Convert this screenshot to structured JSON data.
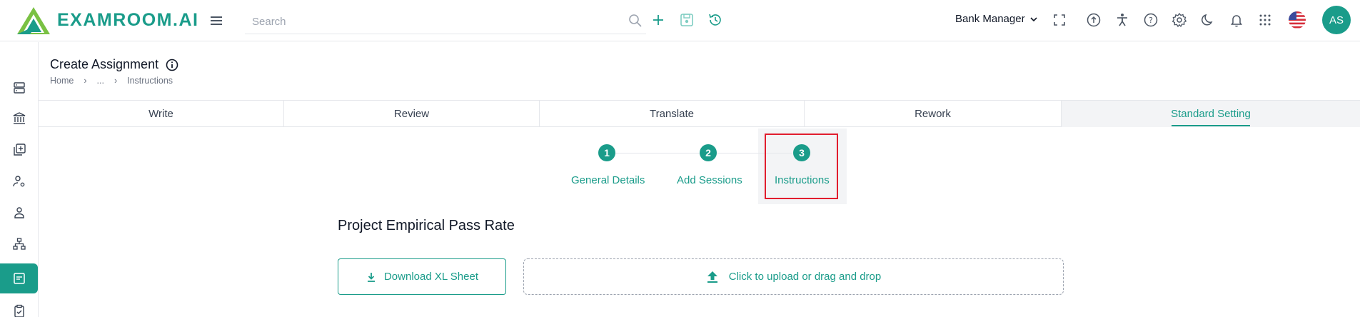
{
  "app": {
    "logo_text": "EXAMROOM.AI",
    "brand_color": "#1a9c8a"
  },
  "header": {
    "search_placeholder": "Search",
    "role_label": "Bank Manager",
    "avatar_initials": "AS",
    "icons": [
      "search-icon",
      "plus-icon",
      "save-icon",
      "history-icon",
      "fullscreen-icon",
      "upload-circle-icon",
      "accessibility-icon",
      "help-icon",
      "settings-icon",
      "dark-mode-icon",
      "notification-icon",
      "apps-grid-icon",
      "us-flag-icon"
    ]
  },
  "sidebar": {
    "items": [
      {
        "icon": "server-icon",
        "active": false
      },
      {
        "icon": "bank-icon",
        "active": false
      },
      {
        "icon": "add-copy-icon",
        "active": false
      },
      {
        "icon": "user-settings-icon",
        "active": false
      },
      {
        "icon": "user-icon",
        "active": false
      },
      {
        "icon": "hierarchy-icon",
        "active": false
      },
      {
        "icon": "assignment-icon",
        "active": true
      },
      {
        "icon": "clipboard-check-icon",
        "active": false
      }
    ]
  },
  "page": {
    "title": "Create Assignment",
    "breadcrumb": [
      "Home",
      "...",
      "Instructions"
    ],
    "breadcrumb_sep": "›"
  },
  "tabs": [
    {
      "label": "Write",
      "active": false
    },
    {
      "label": "Review",
      "active": false
    },
    {
      "label": "Translate",
      "active": false
    },
    {
      "label": "Rework",
      "active": false
    },
    {
      "label": "Standard Setting",
      "active": true
    }
  ],
  "stepper": {
    "steps": [
      {
        "number": "1",
        "label": "General Details"
      },
      {
        "number": "2",
        "label": "Add Sessions"
      },
      {
        "number": "3",
        "label": "Instructions",
        "current": true
      }
    ]
  },
  "section": {
    "title": "Project Empirical Pass Rate",
    "download_label": "Download XL Sheet",
    "upload_label": "Click to upload or drag and drop"
  }
}
